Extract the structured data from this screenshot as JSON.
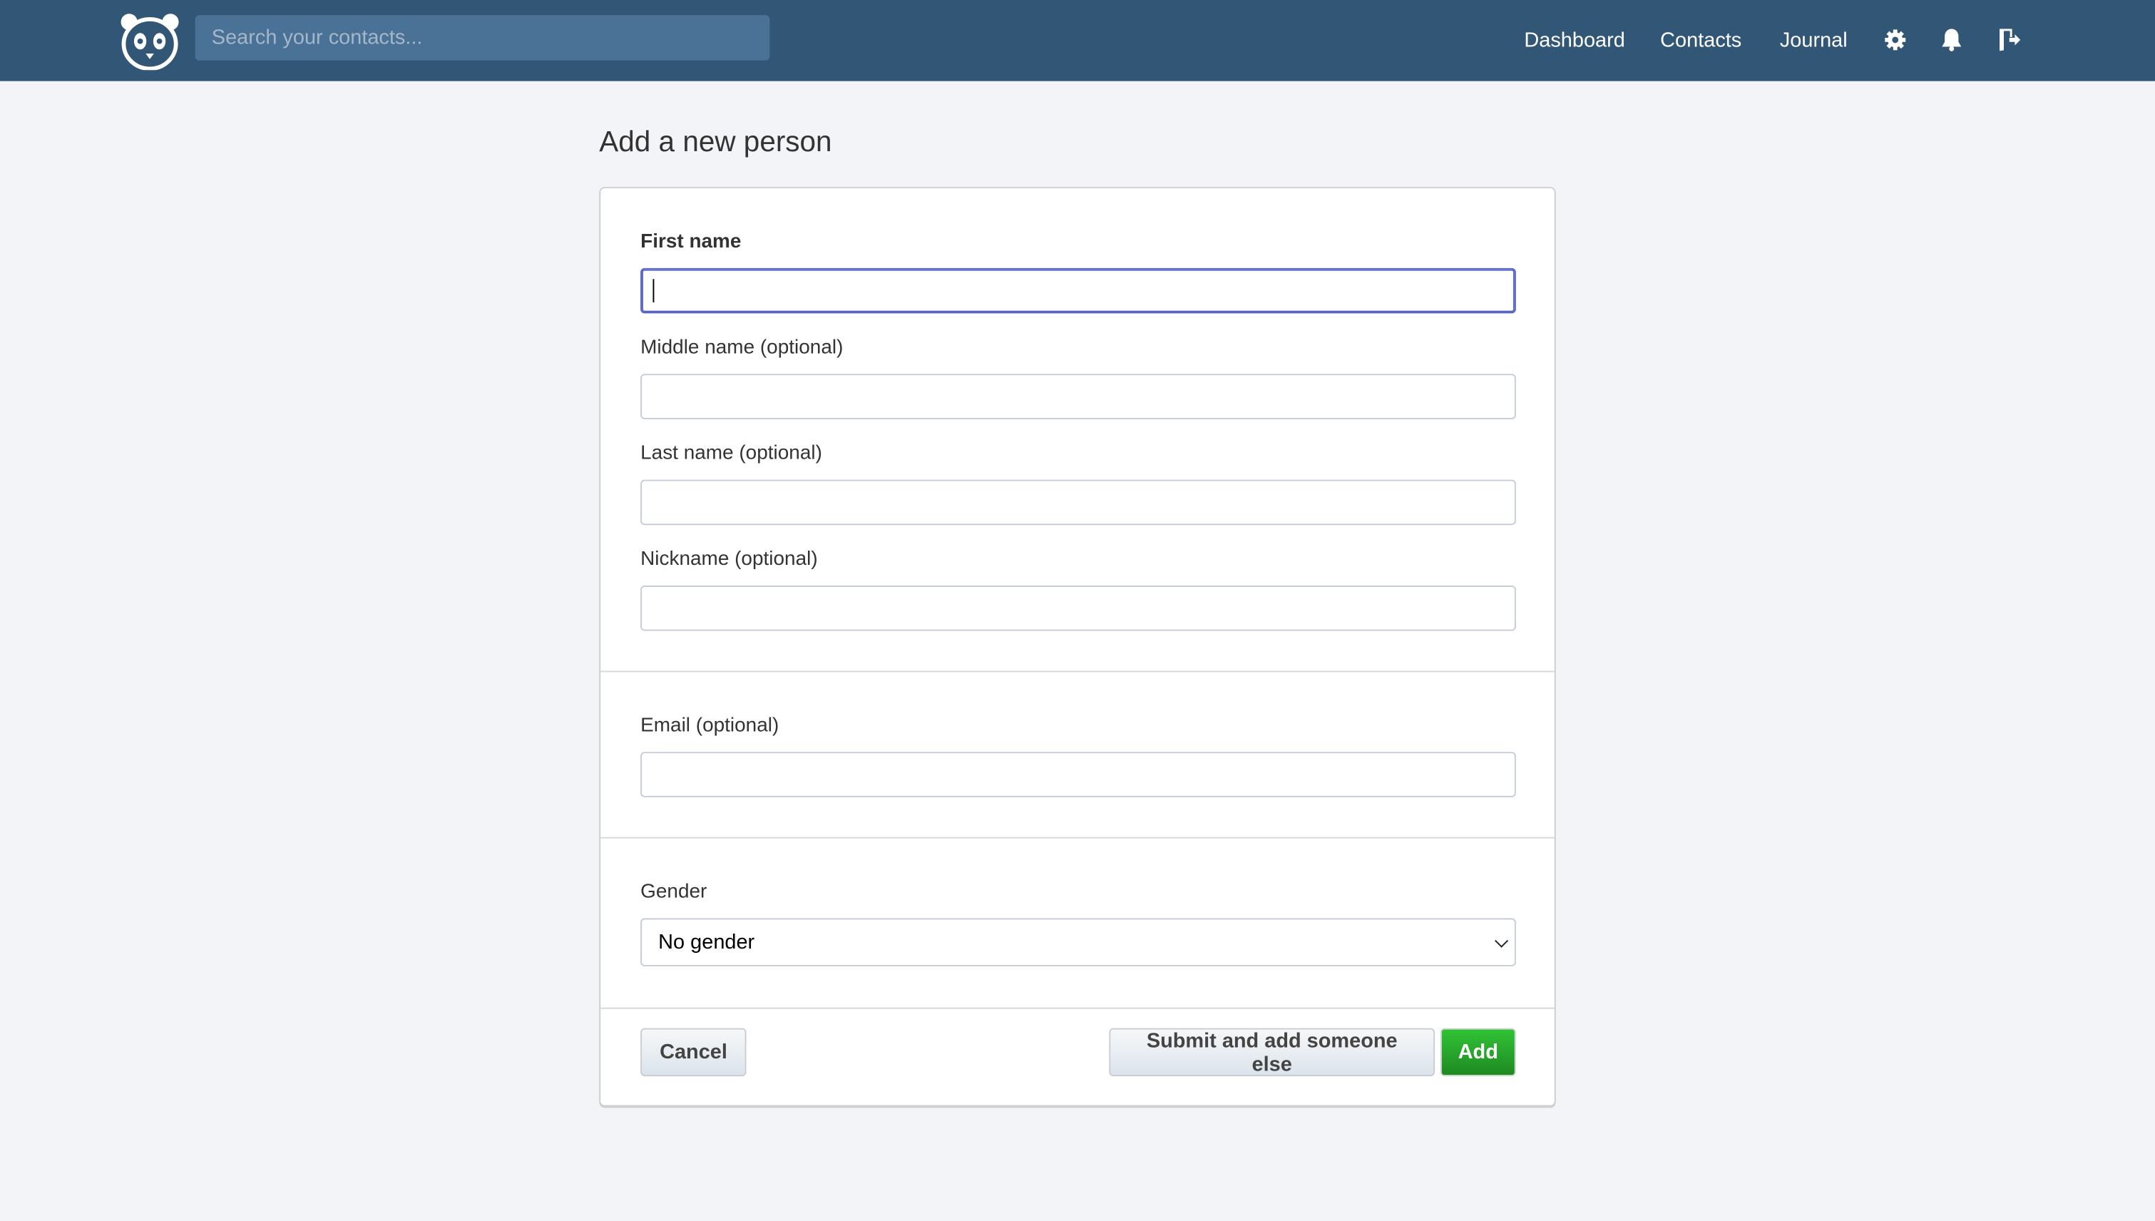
{
  "nav": {
    "search_placeholder": "Search your contacts...",
    "links": [
      "Dashboard",
      "Contacts",
      "Journal"
    ],
    "icons": [
      "panda-logo",
      "gear-icon",
      "bell-icon",
      "logout-door-icon"
    ],
    "bg_color": "#325776"
  },
  "page": {
    "title": "Add a new person"
  },
  "form": {
    "first_name": {
      "label": "First name",
      "value": ""
    },
    "middle_name": {
      "label": "Middle name (optional)",
      "value": ""
    },
    "last_name": {
      "label": "Last name (optional)",
      "value": ""
    },
    "nickname": {
      "label": "Nickname (optional)",
      "value": ""
    },
    "email": {
      "label": "Email (optional)",
      "value": ""
    },
    "gender": {
      "label": "Gender",
      "value": "No gender"
    },
    "cancel_label": "Cancel",
    "submit_another_label": "Submit and add someone else",
    "add_label": "Add",
    "add_color": "#2aa52e"
  }
}
